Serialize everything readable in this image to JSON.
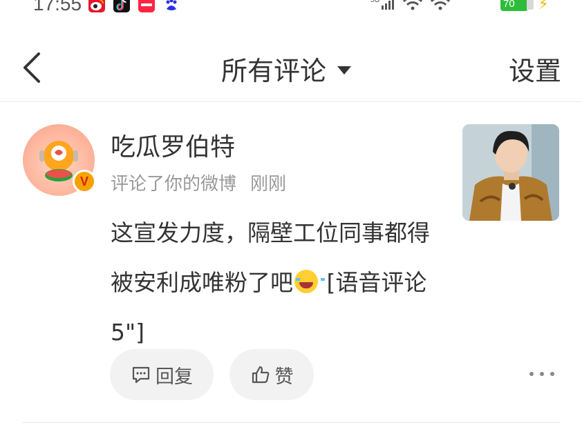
{
  "status_bar": {
    "time": "17:55",
    "network": "5G",
    "battery": "70"
  },
  "nav": {
    "title": "所有评论",
    "settings_label": "设置"
  },
  "comment": {
    "username": "吃瓜罗伯特",
    "action": "评论了你的微博",
    "time": "刚刚",
    "text_part1": "这宣发力度，隔壁工位同事都得被安利成唯粉了吧",
    "text_part2": " [语音评论5\"]",
    "reply_label": "回复",
    "like_label": "赞"
  }
}
